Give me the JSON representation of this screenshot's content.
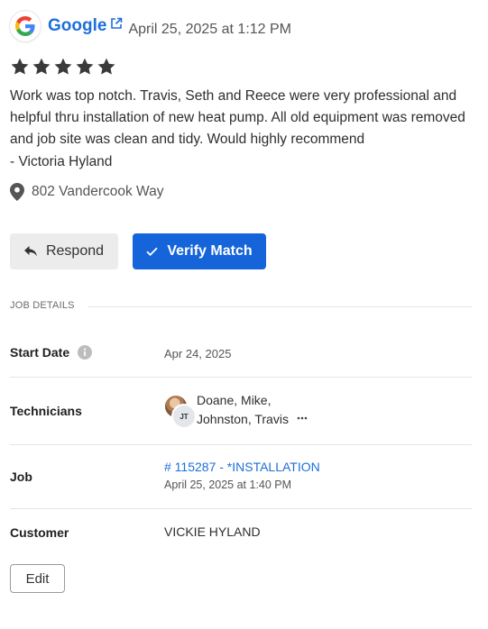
{
  "review": {
    "source": "Google",
    "date": "April 25, 2025 at 1:12 PM",
    "rating": 5,
    "text": "Work was top notch. Travis, Seth and Reece were very professional and helpful thru installation of new heat pump. All old equipment was removed and job site was clean and tidy. Would highly recommend",
    "reviewer": "- Victoria Hyland",
    "location": "802 Vandercook Way"
  },
  "actions": {
    "respond_label": "Respond",
    "verify_label": "Verify Match"
  },
  "job_details": {
    "section_title": "JOB DETAILS",
    "start_date_label": "Start Date",
    "start_date_value": "Apr 24, 2025",
    "technicians_label": "Technicians",
    "technician_avatar_initials": "JT",
    "technicians": [
      "Doane, Mike,",
      "Johnston, Travis"
    ],
    "job_label": "Job",
    "job_value": "# 115287 - *INSTALLATION",
    "job_date": "April 25, 2025 at 1:40 PM",
    "customer_label": "Customer",
    "customer_value": "VICKIE HYLAND"
  },
  "edit_label": "Edit",
  "colors": {
    "accent": "#1564d9",
    "link": "#1e6fd9",
    "star": "#3a3a3a"
  }
}
